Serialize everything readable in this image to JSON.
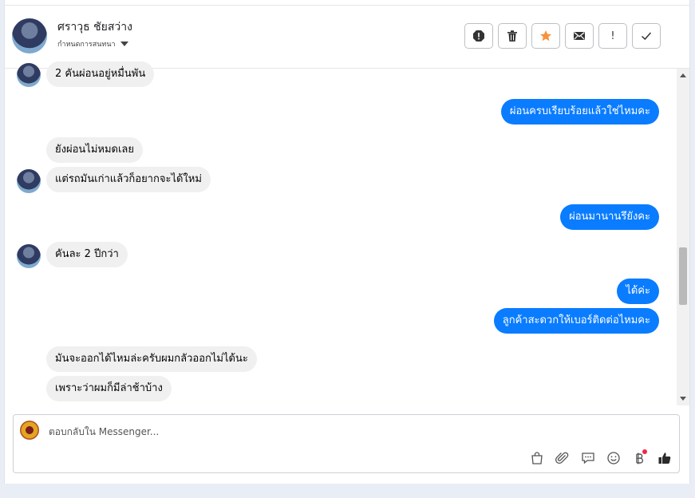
{
  "header": {
    "name": "ศราวุธ ชัยสว่าง",
    "status": "กำหนดการสนทนา"
  },
  "actions": [
    {
      "name": "alert-icon"
    },
    {
      "name": "trash-icon"
    },
    {
      "name": "star-icon",
      "color": "#f7923b"
    },
    {
      "name": "mail-icon"
    },
    {
      "name": "exclamation-icon",
      "glyph": "!"
    },
    {
      "name": "check-icon"
    }
  ],
  "messages": [
    {
      "side": "in",
      "text": "2 คันผ่อนอยู่หมื่นพัน"
    },
    {
      "side": "out",
      "text": "ผ่อนครบเรียบร้อยแล้วใช่ไหมคะ"
    },
    {
      "side": "in",
      "text": "ยังผ่อนไม่หมดเลย"
    },
    {
      "side": "in",
      "text": "แต่รถมันเก่าแล้วก็อยากจะได้ใหม่"
    },
    {
      "side": "out",
      "text": "ผ่อนมานานรึยังคะ"
    },
    {
      "side": "in",
      "text": "คันละ 2 ปีกว่า"
    },
    {
      "side": "out",
      "text": "ได้ค่ะ"
    },
    {
      "side": "out",
      "text": "ลูกค้าสะดวกให้เบอร์ติดต่อไหมคะ"
    },
    {
      "side": "in",
      "text": "มันจะออกได้ไหมล่ะครับผมกลัวออกไม่ได้นะ"
    },
    {
      "side": "in",
      "text": "เพราะว่าผมก็มีล่าช้าบ้าง"
    }
  ],
  "composer": {
    "placeholder": "ตอบกลับใน Messenger..."
  },
  "colors": {
    "outgoing_bubble": "#0a7cff",
    "incoming_bubble": "#f0f0f0",
    "like_icon": "#2b2b2b"
  }
}
